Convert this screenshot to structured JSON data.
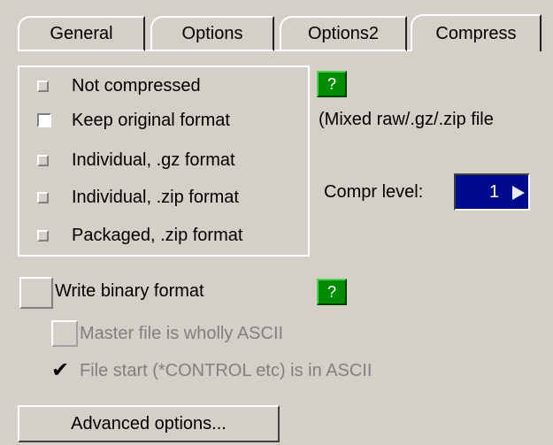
{
  "tabs": [
    {
      "label": "General",
      "active": false
    },
    {
      "label": "Options",
      "active": false
    },
    {
      "label": "Options2",
      "active": false
    },
    {
      "label": "Compress",
      "active": true
    }
  ],
  "compression": {
    "options": [
      {
        "label": "Not compressed",
        "selected": false
      },
      {
        "label": "Keep original format",
        "selected": true
      },
      {
        "label": "Individual, .gz format",
        "selected": false
      },
      {
        "label": "Individual, .zip format",
        "selected": false
      },
      {
        "label": "Packaged, .zip format",
        "selected": false
      }
    ],
    "help_label": "?",
    "mixed_note": "(Mixed raw/.gz/.zip file",
    "level_label": "Compr level:",
    "level_value": "1"
  },
  "binary": {
    "write_label": "Write binary format",
    "write_checked": false,
    "help_label": "?",
    "master_label": "Master file is wholly ASCII",
    "master_checked": false,
    "filestart_label": "File start (*CONTROL etc) is in ASCII",
    "filestart_checked": true
  },
  "advanced_label": "Advanced options...",
  "colors": {
    "background": "#d4d0c8",
    "help_green": "#008c00",
    "level_blue": "#000a8c"
  },
  "icons": [
    "help-icon",
    "dropdown-arrow-icon",
    "checkmark-icon"
  ]
}
